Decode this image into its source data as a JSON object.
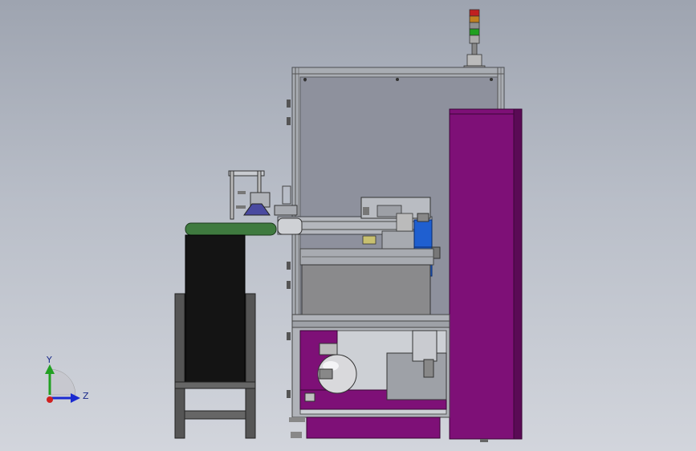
{
  "viewport": {
    "background_top": "#9ea4b0",
    "background_bottom": "#d2d5dc"
  },
  "triad": {
    "y_label": "Y",
    "z_label": "Z",
    "y_color": "#22a022",
    "z_color": "#1a2ad0",
    "origin_color": "#d02020"
  },
  "colors": {
    "frame": "#a9adb3",
    "frame_dark": "#6e7278",
    "window_panel": "#8e919d",
    "magenta": "#7e1077",
    "magenta_dark": "#5a0a55",
    "belt_green": "#3f7a3f",
    "belt_black": "#141414",
    "motor_blue": "#1f5fd0",
    "tank_silver": "#d9d9dc",
    "signal_red": "#c02020",
    "signal_yellow": "#d0a020",
    "signal_green": "#20a020"
  }
}
